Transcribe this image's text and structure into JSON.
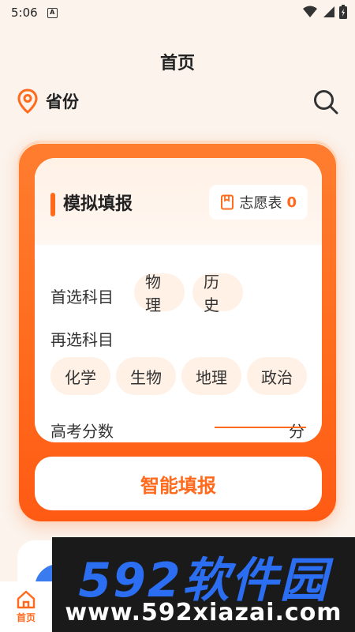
{
  "status_bar": {
    "time": "5:06",
    "badge": "A"
  },
  "page_title": "首页",
  "location": {
    "label": "省份"
  },
  "simulate": {
    "title": "模拟填报",
    "wish_list_label": "志愿表",
    "wish_list_count": "0",
    "first_subject_label": "首选科目",
    "first_subjects": [
      "物理",
      "历史"
    ],
    "second_subject_label": "再选科目",
    "second_subjects": [
      "化学",
      "生物",
      "地理",
      "政治"
    ],
    "score_label": "高考分数",
    "score_unit": "分",
    "smart_button": "智能填报"
  },
  "tab_bar": {
    "home_label": "首页"
  },
  "watermark": {
    "main": "592软件园",
    "url": "www.592xiazai.com"
  },
  "colors": {
    "accent": "#ff6a1c",
    "background": "#fbf3ec",
    "chip_bg": "#fff1e6"
  }
}
